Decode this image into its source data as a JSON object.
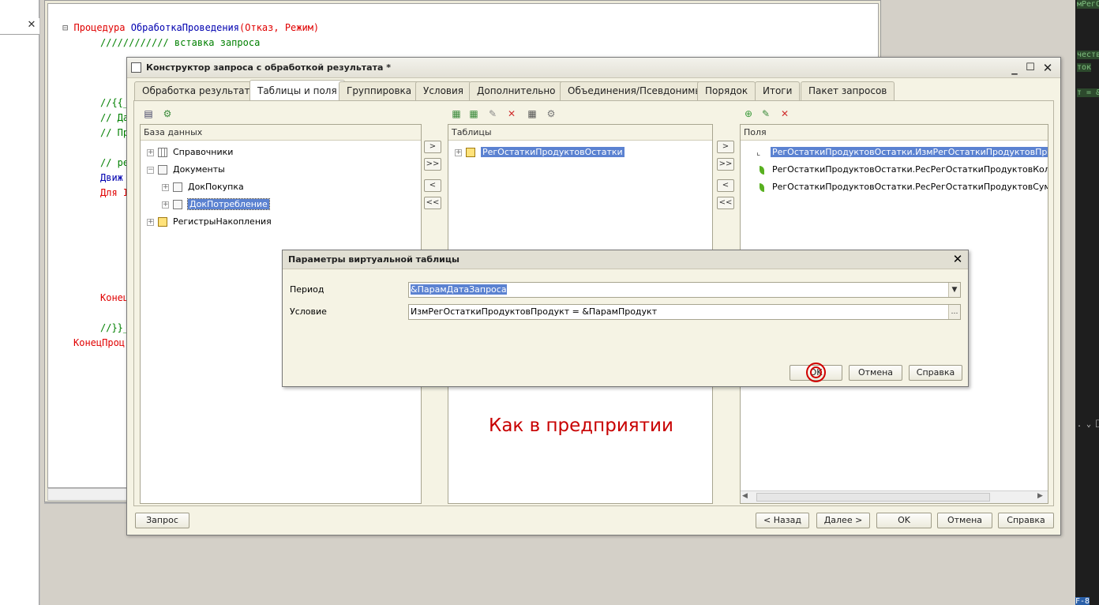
{
  "dialog": {
    "title": "Конструктор запроса с обработкой результата *",
    "tabs": [
      "Обработка результата",
      "Таблицы и поля",
      "Группировка",
      "Условия",
      "Дополнительно",
      "Объединения/Псевдонимы",
      "Порядок",
      "Итоги",
      "Пакет запросов"
    ],
    "active_tab": "Таблицы и поля"
  },
  "database_pane": {
    "header": "База данных",
    "items": [
      "Справочники",
      "Документы",
      "ДокПокупка",
      "ДокПотребление",
      "РегистрыНакопления"
    ]
  },
  "tables_pane": {
    "header": "Таблицы",
    "items": [
      "РегОстаткиПродуктовОстатки"
    ]
  },
  "fields_pane": {
    "header": "Поля",
    "items": [
      "РегОстаткиПродуктовОстатки.ИзмРегОстаткиПродуктовПродук",
      "РегОстаткиПродуктовОстатки.РесРегОстаткиПродуктовКоличе",
      "РегОстаткиПродуктовОстатки.РесРегОстаткиПродуктовСуммаО"
    ]
  },
  "move_buttons": [
    ">",
    ">>",
    "<",
    "<<"
  ],
  "bottom_buttons": {
    "query": "Запрос",
    "back": "< Назад",
    "next": "Далее >",
    "ok": "OK",
    "cancel": "Отмена",
    "help": "Справка"
  },
  "virtual_params": {
    "title": "Параметры виртуальной таблицы",
    "period_label": "Период",
    "period_value": "&ПарамДатаЗапроса",
    "condition_label": "Условие",
    "condition_value": "ИзмРегОстаткиПродуктовПродукт = &ПарамПродукт",
    "ok": "OK",
    "cancel": "Отмена",
    "help": "Справка"
  },
  "overlay_text": "Как в предприятии",
  "code": {
    "line1_kw": "Процедура",
    "line1_name": "ОбработкаПроведения",
    "line1_params": "(Отказ, Режим)",
    "line2": "//////////// вставка запроса",
    "line3": "//{{_",
    "line4": "// Да",
    "line5": "// Пр",
    "line6": "// ре",
    "line7": "Движ",
    "line8": "Для I",
    "line9": "Конец",
    "line10": "//}}_",
    "line11": "КонецПроц"
  },
  "dark_strip_texts": [
    "мРегО",
    "честв",
    "ток",
    "т = &",
    ". ⌄ ⎕",
    "F-8"
  ]
}
